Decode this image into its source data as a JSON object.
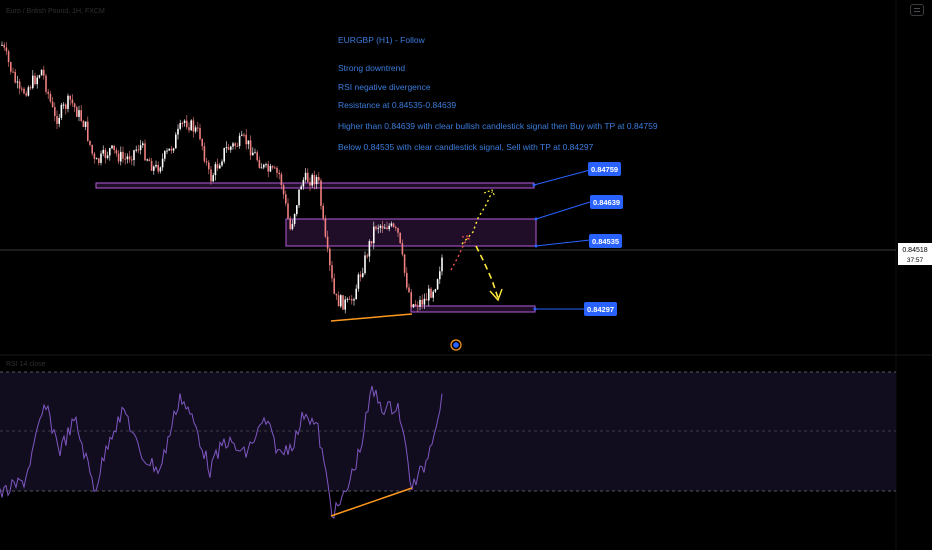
{
  "header": {
    "symbol_line": "Euro / British Pound, 1H, FXCM"
  },
  "annotation": {
    "title": "EURGBP (H1) - Follow",
    "notes": [
      "Strong downtrend",
      "RSI negative divergence",
      "Resistance at 0.84535-0.84639",
      "Higher than 0.84639 with clear bullish candlestick signal then Buy with TP at 0.84759",
      "Below 0.84535 with clear candlestick signal, Sell with TP at 0.84297"
    ]
  },
  "levels": {
    "l1": "0.84759",
    "l2": "0.84639",
    "l3": "0.84535",
    "l4": "0.84297"
  },
  "current_price": {
    "price": "0.84518",
    "countdown": "37:57"
  },
  "rsi": {
    "label": "RSI 14 close"
  },
  "colors": {
    "background": "#000000",
    "candle_up": "#ffffff",
    "candle_down": "#f08080",
    "zone_border": "#b45bd9",
    "tag_bg": "#2962ff",
    "rsi_line": "#7e57c2",
    "divergence": "#ff9a1f",
    "arrow_yellow": "#ffeb3b",
    "arrow_red": "#ef5350"
  }
}
